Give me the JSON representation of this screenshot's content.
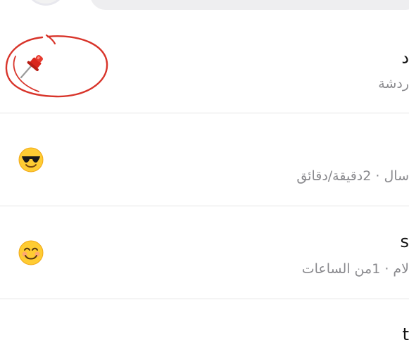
{
  "search": {
    "placeholder": ""
  },
  "conversations": [
    {
      "name": "د",
      "subtitle": "ردشة",
      "icon": "pushpin-icon",
      "annotation": "red-circle-around-pin"
    },
    {
      "name": "",
      "subtitle": "سال · 2دقيقة/دقائق",
      "icon": "sunglasses-emoji-icon"
    },
    {
      "name": "s",
      "subtitle": "لام · 1من الساعات",
      "icon": "smiling-emoji-icon"
    },
    {
      "name": "t",
      "subtitle": "",
      "icon": ""
    }
  ],
  "colors": {
    "annotation_red": "#d8342a",
    "pin_red": "#d9261c",
    "divider": "#e5e5e5",
    "subtitle_gray": "#8a8a8e"
  }
}
